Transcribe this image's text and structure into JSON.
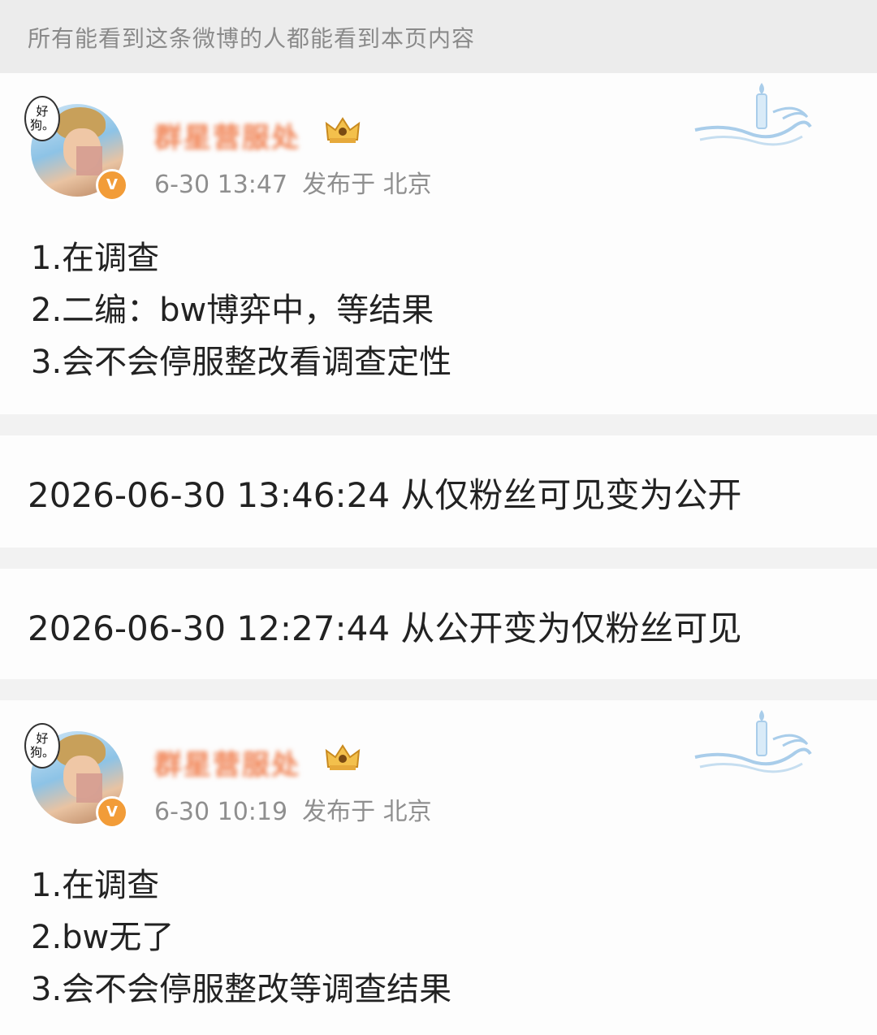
{
  "notice": "所有能看到这条微博的人都能看到本页内容",
  "posts": [
    {
      "username": "群星营服处",
      "avatar_bubble": "好狗。",
      "time": "6-30 13:47",
      "location": "发布于 北京",
      "lines": [
        "1.在调查",
        "2.二编：bw博弈中，等结果",
        "3.会不会停服整改看调查定性"
      ]
    },
    {
      "username": "群星营服处",
      "avatar_bubble": "好狗。",
      "time": "6-30 10:19",
      "location": "发布于 北京",
      "lines": [
        "1.在调查",
        "2.bw无了",
        "3.会不会停服整改等调查结果"
      ]
    }
  ],
  "logs": [
    "2026-06-30 13:46:24 从仅粉丝可见变为公开",
    "2026-06-30 12:27:44 从公开变为仅粉丝可见"
  ],
  "icons": {
    "verified_badge": "verified-icon",
    "crown": "crown-icon",
    "decoration": "candle-wave-icon"
  },
  "colors": {
    "username": "#f08050",
    "verified": "#f29c38",
    "meta": "#8f8f8f",
    "decoration": "#a9cdea"
  }
}
